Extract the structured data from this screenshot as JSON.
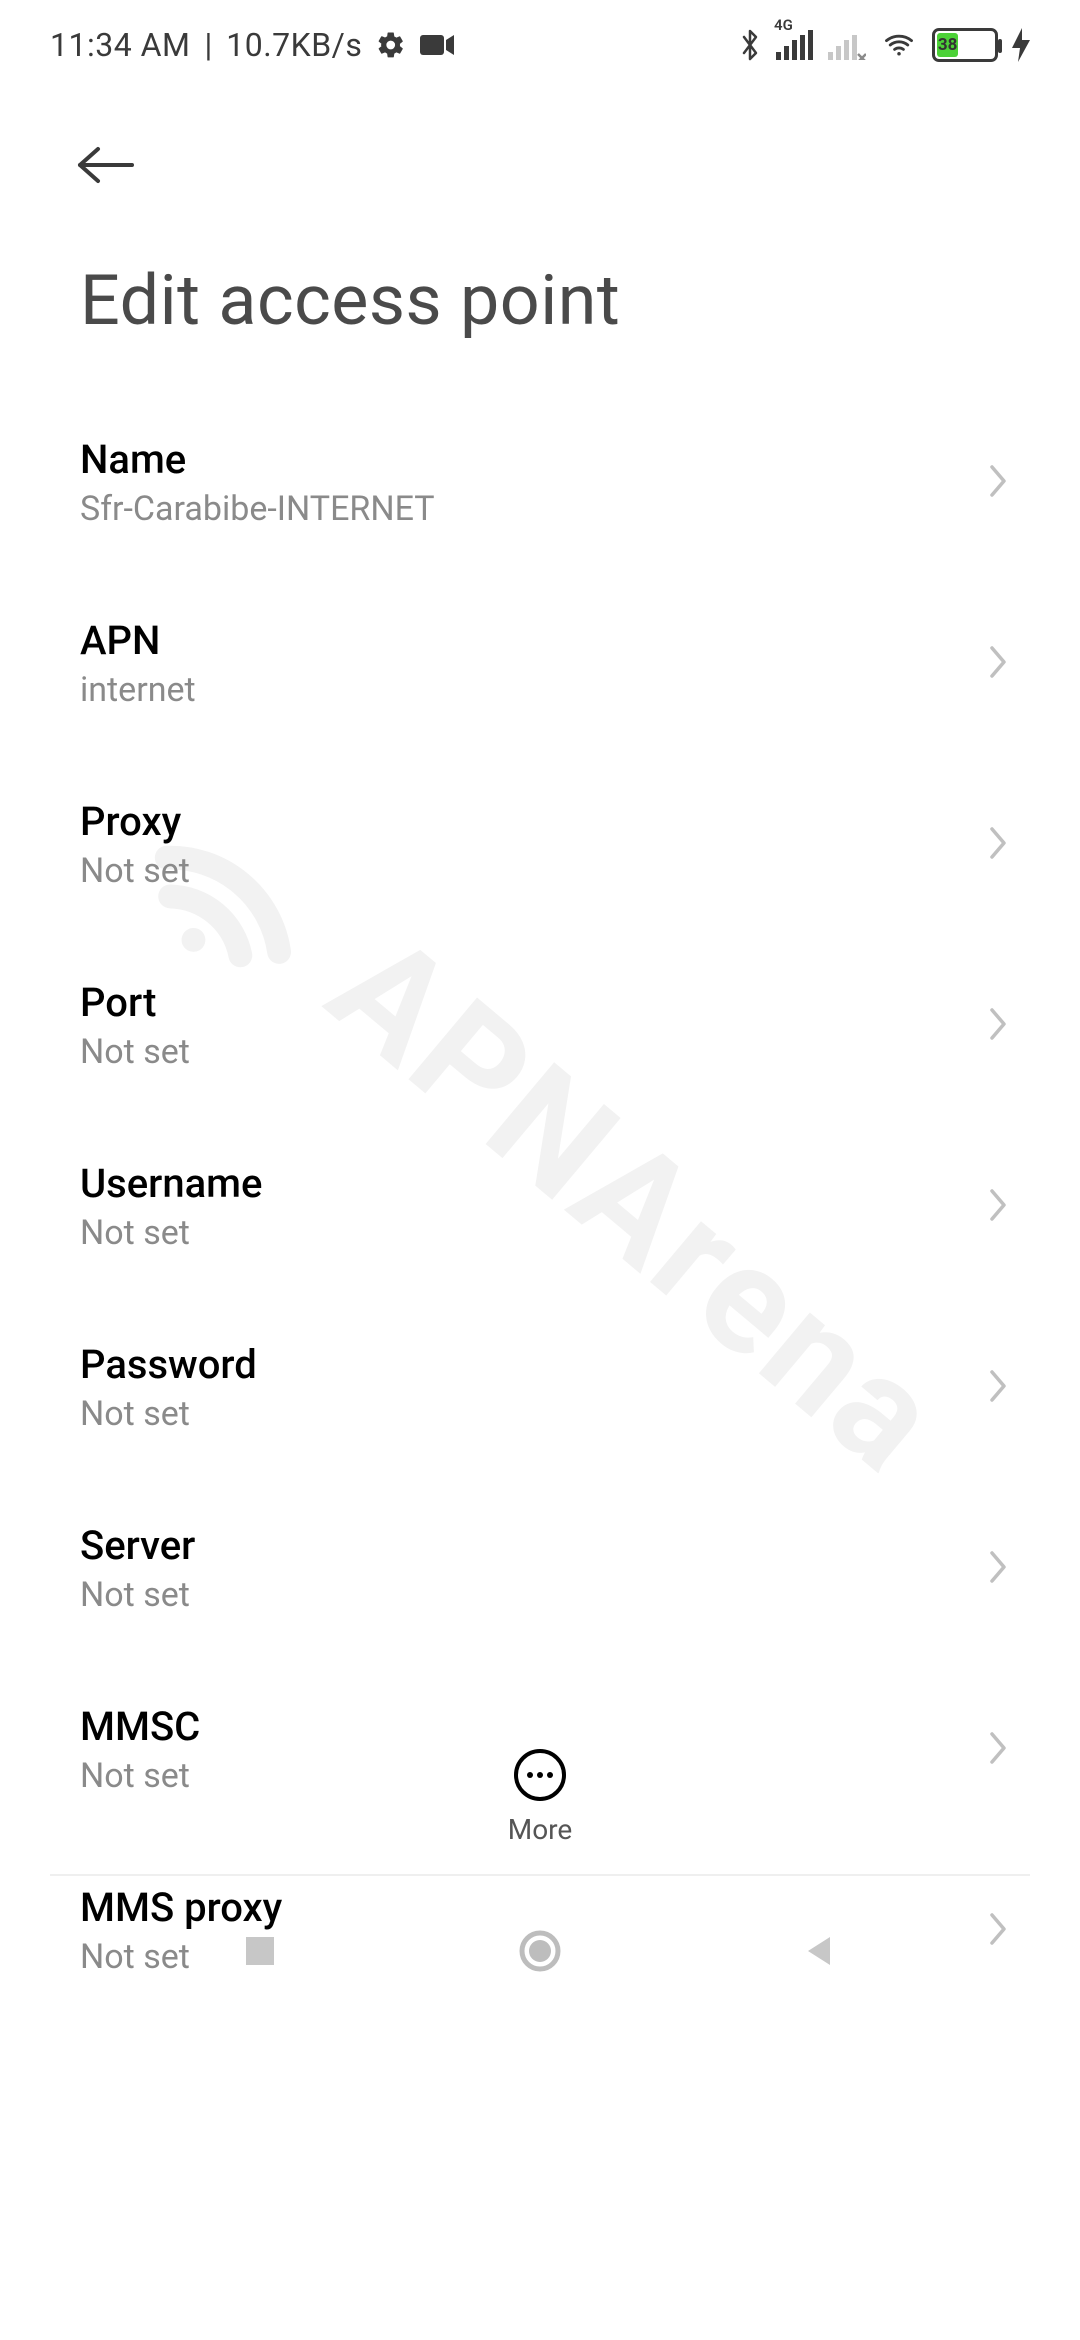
{
  "status": {
    "time": "11:34 AM",
    "net_speed": "10.7KB/s",
    "network_tag": "4G",
    "battery_pct": 38
  },
  "page": {
    "title": "Edit access point"
  },
  "fields": {
    "name": {
      "label": "Name",
      "value": "Sfr-Carabibe-INTERNET"
    },
    "apn": {
      "label": "APN",
      "value": "internet"
    },
    "proxy": {
      "label": "Proxy",
      "value": "Not set"
    },
    "port": {
      "label": "Port",
      "value": "Not set"
    },
    "username": {
      "label": "Username",
      "value": "Not set"
    },
    "password": {
      "label": "Password",
      "value": "Not set"
    },
    "server": {
      "label": "Server",
      "value": "Not set"
    },
    "mmsc": {
      "label": "MMSC",
      "value": "Not set"
    },
    "mms_proxy": {
      "label": "MMS proxy",
      "value": "Not set"
    }
  },
  "more": {
    "label": "More"
  },
  "watermark": {
    "text": "APNArena"
  }
}
